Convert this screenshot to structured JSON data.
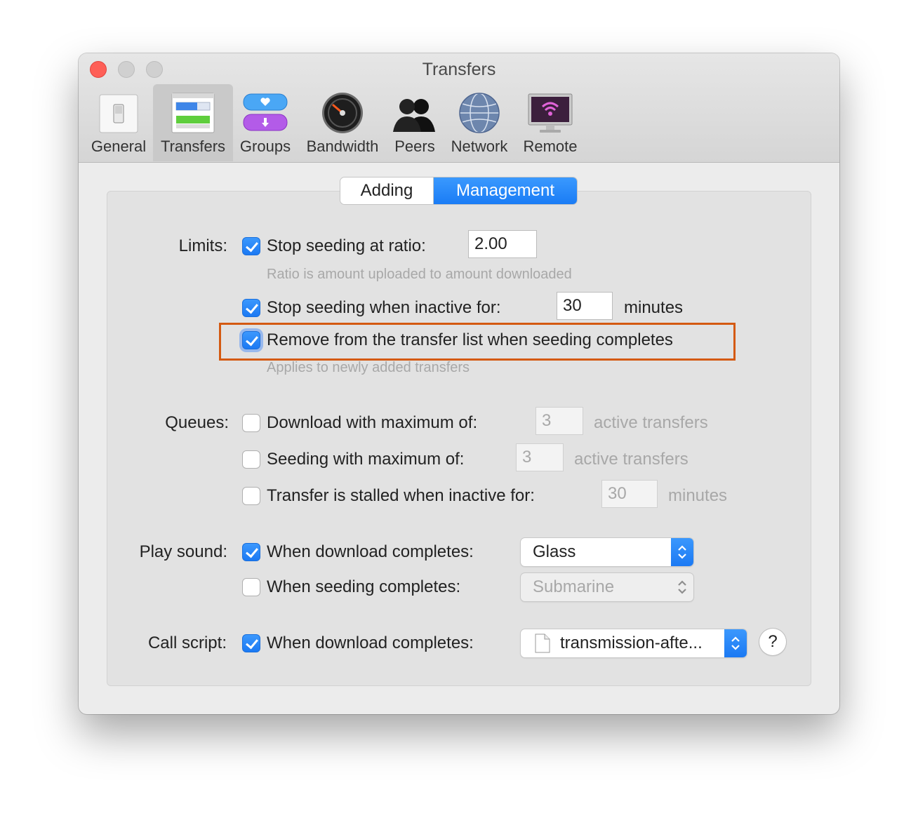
{
  "window": {
    "title": "Transfers"
  },
  "toolbar": {
    "items": [
      {
        "label": "General",
        "icon": "switch-icon"
      },
      {
        "label": "Transfers",
        "icon": "transfers-icon",
        "selected": true
      },
      {
        "label": "Groups",
        "icon": "groups-icon"
      },
      {
        "label": "Bandwidth",
        "icon": "speedometer-icon"
      },
      {
        "label": "Peers",
        "icon": "peers-icon"
      },
      {
        "label": "Network",
        "icon": "globe-icon"
      },
      {
        "label": "Remote",
        "icon": "remote-display-icon"
      }
    ]
  },
  "tabs": [
    {
      "label": "Adding",
      "selected": false
    },
    {
      "label": "Management",
      "selected": true
    }
  ],
  "limits": {
    "label": "Limits:",
    "stop_ratio": {
      "label": "Stop seeding at ratio:",
      "checked": true,
      "value": "2.00"
    },
    "ratio_hint": "Ratio is amount uploaded to amount downloaded",
    "stop_inactive": {
      "label": "Stop seeding when inactive for:",
      "checked": true,
      "value": "30",
      "unit": "minutes"
    },
    "remove_complete": {
      "label": "Remove from the transfer list when seeding completes",
      "checked": true
    },
    "remove_hint": "Applies to newly added transfers"
  },
  "queues": {
    "label": "Queues:",
    "download_max": {
      "label": "Download with maximum of:",
      "checked": false,
      "value": "3",
      "unit": "active transfers"
    },
    "seeding_max": {
      "label": "Seeding with maximum of:",
      "checked": false,
      "value": "3",
      "unit": "active transfers"
    },
    "stalled": {
      "label": "Transfer is stalled when inactive for:",
      "checked": false,
      "value": "30",
      "unit": "minutes"
    }
  },
  "play_sound": {
    "label": "Play sound:",
    "download": {
      "label": "When download completes:",
      "checked": true,
      "value": "Glass"
    },
    "seeding": {
      "label": "When seeding completes:",
      "checked": false,
      "value": "Submarine"
    }
  },
  "call_script": {
    "label": "Call script:",
    "download": {
      "label": "When download completes:",
      "checked": true,
      "value": "transmission-afte..."
    },
    "help": "?"
  },
  "colors": {
    "accent": "#1b79f3",
    "highlight_border": "#d45a12",
    "close_button": "#fe5f57"
  }
}
